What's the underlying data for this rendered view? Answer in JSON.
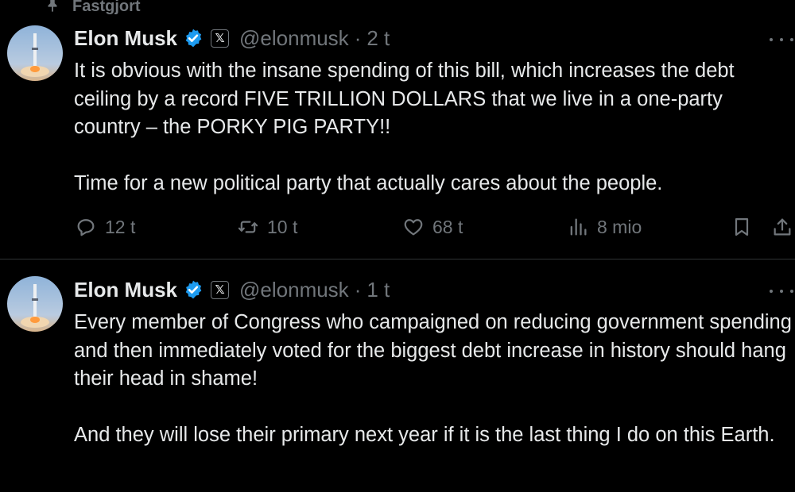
{
  "pinned": {
    "label": "Fastgjort"
  },
  "tweets": [
    {
      "name": "Elon Musk",
      "affiliate_badge": "𝕏",
      "handle": "@elonmusk",
      "separator": "·",
      "time": "2 t",
      "paragraphs": [
        "It is obvious with the insane spending of this bill, which increases the debt ceiling by a record FIVE TRILLION DOLLARS that we live in a one-party country – the PORKY PIG PARTY!!",
        "Time for a new political party that actually cares about the people."
      ],
      "actions": {
        "replies": "12 t",
        "reposts": "10 t",
        "likes": "68 t",
        "views": "8 mio"
      }
    },
    {
      "name": "Elon Musk",
      "affiliate_badge": "𝕏",
      "handle": "@elonmusk",
      "separator": "·",
      "time": "1 t",
      "paragraphs": [
        "Every member of Congress who campaigned on reducing government spending and then immediately voted for the biggest debt increase in history should hang their head in shame!",
        "And they will lose their primary next year if it is the last thing I do on this Earth."
      ]
    }
  ],
  "colors": {
    "background": "#000000",
    "text": "#e7e9ea",
    "muted": "#71767b",
    "verified_blue": "#1d9bf0",
    "divider": "#2f3336"
  },
  "icons": [
    "pin-icon",
    "verified-badge-icon",
    "reply-icon",
    "repost-icon",
    "like-icon",
    "views-icon",
    "bookmark-icon",
    "share-icon",
    "more-icon"
  ]
}
